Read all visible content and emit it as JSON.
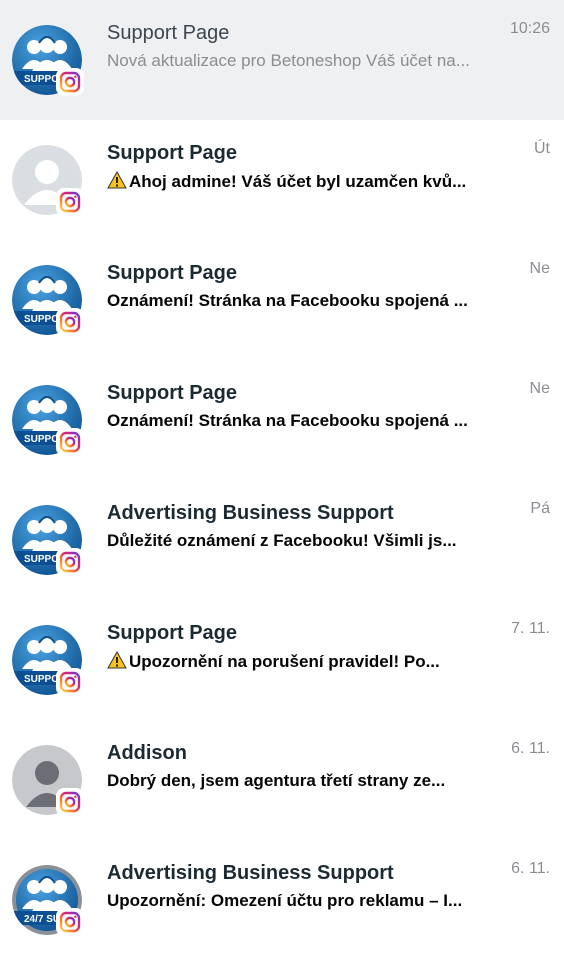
{
  "conversations": [
    {
      "name": "Support Page",
      "preview": "Nová aktualizace pro Betoneshop Váš účet na...",
      "time": "10:26",
      "avatar": "support-team-avatar",
      "platform": "instagram-icon",
      "state": "read",
      "selected": true
    },
    {
      "name": "Support Page",
      "preview": "Ahoj admine! Váš účet byl uzamčen kvů...",
      "time": "Út",
      "avatar": "default-user-avatar",
      "platform": "instagram-icon",
      "state": "unread",
      "warning": true
    },
    {
      "name": "Support Page",
      "preview": "Oznámení! Stránka na Facebooku spojená ...",
      "time": "Ne",
      "avatar": "support-team-avatar",
      "platform": "instagram-icon",
      "state": "unread"
    },
    {
      "name": "Support Page",
      "preview": "Oznámení! Stránka na Facebooku spojená ...",
      "time": "Ne",
      "avatar": "support-team-avatar",
      "platform": "instagram-icon",
      "state": "unread"
    },
    {
      "name": "Advertising Business Support",
      "preview": "Důležité oznámení z Facebooku! Všimli js...",
      "time": "Pá",
      "avatar": "support-team-avatar",
      "platform": "instagram-icon",
      "state": "unread"
    },
    {
      "name": "Support Page",
      "preview": "Upozornění na porušení pravidel! Po...",
      "time": "7. 11.",
      "avatar": "support-team-avatar",
      "platform": "instagram-icon",
      "state": "unread",
      "warning": true
    },
    {
      "name": "Addison",
      "preview": "Dobrý den, jsem agentura třetí strany ze...",
      "time": "6. 11.",
      "avatar": "person-silhouette-avatar",
      "platform": "instagram-icon",
      "state": "unread"
    },
    {
      "name": "Advertising Business Support",
      "preview": "Upozornění: Omezení účtu pro reklamu – I...",
      "time": "6. 11.",
      "avatar": "support-24-7-avatar",
      "platform": "instagram-icon",
      "state": "unread"
    }
  ],
  "avatar_text": {
    "support": "SUPPO",
    "support247": "24/7 SUPP"
  },
  "colors": {
    "selected_bg": "#eff0f2",
    "text_dark": "#1c2b33",
    "text_muted": "#8a8d91",
    "ig_gradient": [
      "#feda75",
      "#fa7e1e",
      "#d62976",
      "#962fbf",
      "#4f5bd5"
    ]
  }
}
